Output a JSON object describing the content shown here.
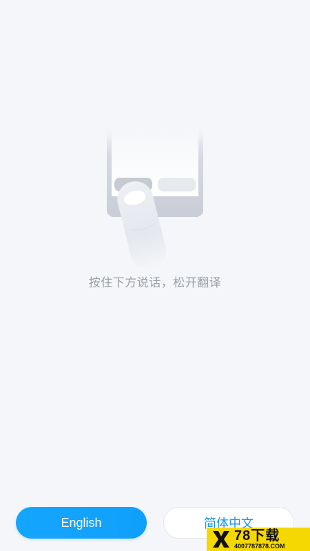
{
  "hint": {
    "text": "按住下方说话，松开翻译"
  },
  "buttons": {
    "left_label": "English",
    "right_label": "简体中文"
  },
  "watermark": {
    "title": "78下载",
    "subtitle": "4007787878.COM"
  },
  "colors": {
    "background": "#f4f6f9",
    "accent": "#14a6ff",
    "hint_text": "#9a9ea5",
    "watermark_bg": "#f5d800"
  }
}
